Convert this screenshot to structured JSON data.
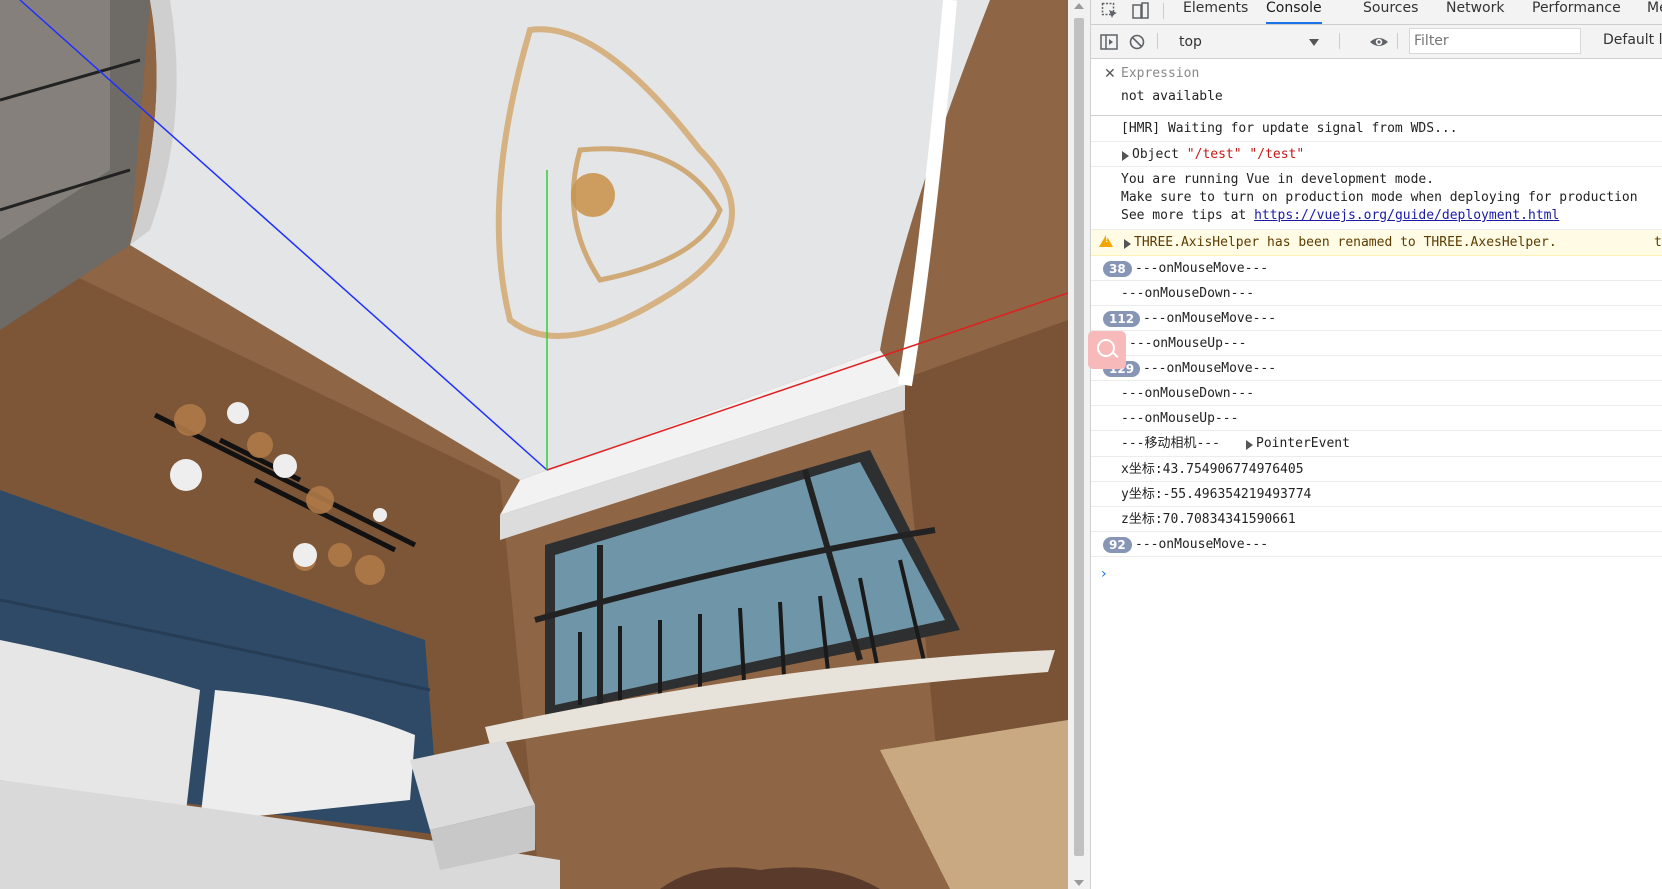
{
  "devtools": {
    "tabs": [
      "Elements",
      "Console",
      "Sources",
      "Network",
      "Performance",
      "Me"
    ],
    "active_tab": "Console",
    "context_value": "top",
    "filter_placeholder": "Filter",
    "levels_label": "Default le",
    "expression": {
      "label": "Expression",
      "value": "not available"
    },
    "messages": {
      "hmr": "[HMR] Waiting for update signal from WDS...",
      "object_prefix": "Object",
      "object_str1": "\"/test\"",
      "object_str2": "\"/test\"",
      "vue_line1": "You are running Vue in development mode.",
      "vue_line2": "Make sure to turn on production mode when deploying for production",
      "vue_line3_prefix": "See more tips at ",
      "vue_link": "https://vuejs.org/guide/deployment.html",
      "warning": "THREE.AxisHelper has been renamed to THREE.AxesHelper.",
      "warning_source": "t",
      "m1_count": "38",
      "m1_text": "---onMouseMove---",
      "m2_text": "---onMouseDown---",
      "m3_count": "112",
      "m3_text": "---onMouseMove---",
      "m4_text": "---onMouseUp---",
      "m5_count": "129",
      "m5_text": "---onMouseMove---",
      "m6_text": "---onMouseDown---",
      "m7_text": "---onMouseUp---",
      "m8_text": "---移动相机---",
      "m8_object": "PointerEvent",
      "x_coord": "x坐标:43.754906774976405",
      "y_coord": "y坐标:-55.496354219493774",
      "z_coord": "z坐标:70.70834341590661",
      "m9_count": "92",
      "m9_text": "---onMouseMove---"
    },
    "prompt_symbol": "›"
  },
  "colors": {
    "accent": "#1a73e8",
    "badge": "#8796b6",
    "warning_bg": "#fffbe5",
    "string": "#c41a16"
  }
}
